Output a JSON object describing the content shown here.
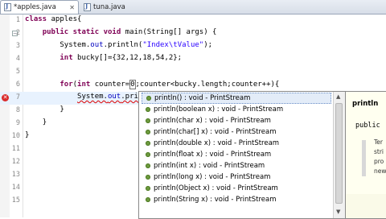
{
  "tabs": [
    {
      "label": "*apples.java",
      "close": "✕"
    },
    {
      "label": "tuna.java",
      "close": ""
    }
  ],
  "editor": {
    "line_numbers": [
      "1",
      "2",
      "3",
      "4",
      "5",
      "6",
      "7",
      "8",
      "9",
      "10",
      "11",
      "12",
      "13",
      "14",
      "15"
    ],
    "code": {
      "l1_kw": "class",
      "l1_rest": " apples{",
      "l2_kw1": "public",
      "l2_kw2": "static",
      "l2_kw3": "void",
      "l2_rest": " main(String[] args) {",
      "l3_pre": "System.",
      "l3_out": "out",
      "l3_mid": ".println(",
      "l3_str": "\"Index\\tValue\"",
      "l3_end": ");",
      "l4_kw": "int",
      "l4_rest": " bucky[]={32,12,18,54,2};",
      "l6_kw1": "for",
      "l6_kw2": "int",
      "l6_a": " counter=",
      "l6_caret": "0",
      "l6_b": ";counter<bucky.length;counter++){",
      "l7_pre": "System.",
      "l7_out": "out",
      "l7_rest": ".println",
      "l8": "}",
      "l9": "}",
      "l10": "}"
    }
  },
  "autocomplete": {
    "items": [
      {
        "sig": "println() : void - PrintStream"
      },
      {
        "sig": "println(boolean x) : void - PrintStream"
      },
      {
        "sig": "println(char x) : void - PrintStream"
      },
      {
        "sig": "println(char[] x) : void - PrintStream"
      },
      {
        "sig": "println(double x) : void - PrintStream"
      },
      {
        "sig": "println(float x) : void - PrintStream"
      },
      {
        "sig": "println(int x) : void - PrintStream"
      },
      {
        "sig": "println(long x) : void - PrintStream"
      },
      {
        "sig": "println(Object x) : void - PrintStream"
      },
      {
        "sig": "println(String x) : void - PrintStream"
      }
    ],
    "selected_index": 0
  },
  "javadoc": {
    "title": "println",
    "signature": "public",
    "fragments": [
      "Ter",
      "stri",
      "pro",
      "new"
    ]
  }
}
